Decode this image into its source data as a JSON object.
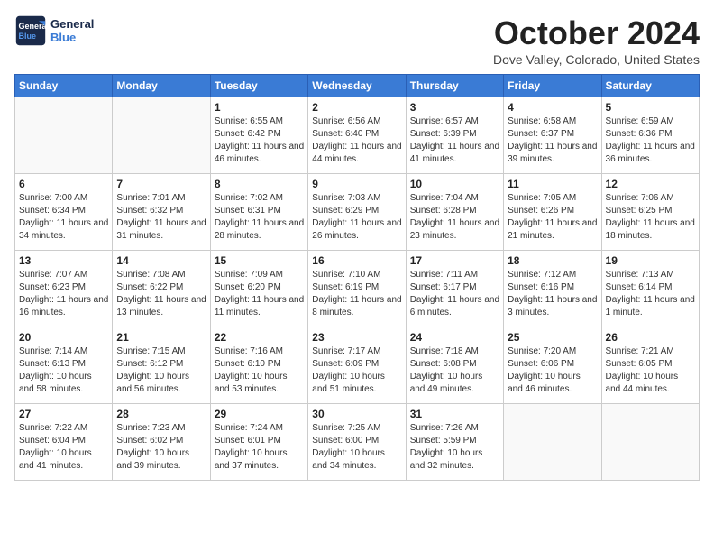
{
  "logo": {
    "line1": "General",
    "line2": "Blue"
  },
  "title": "October 2024",
  "location": "Dove Valley, Colorado, United States",
  "weekdays": [
    "Sunday",
    "Monday",
    "Tuesday",
    "Wednesday",
    "Thursday",
    "Friday",
    "Saturday"
  ],
  "weeks": [
    [
      {
        "day": "",
        "sunrise": "",
        "sunset": "",
        "daylight": ""
      },
      {
        "day": "",
        "sunrise": "",
        "sunset": "",
        "daylight": ""
      },
      {
        "day": "1",
        "sunrise": "Sunrise: 6:55 AM",
        "sunset": "Sunset: 6:42 PM",
        "daylight": "Daylight: 11 hours and 46 minutes."
      },
      {
        "day": "2",
        "sunrise": "Sunrise: 6:56 AM",
        "sunset": "Sunset: 6:40 PM",
        "daylight": "Daylight: 11 hours and 44 minutes."
      },
      {
        "day": "3",
        "sunrise": "Sunrise: 6:57 AM",
        "sunset": "Sunset: 6:39 PM",
        "daylight": "Daylight: 11 hours and 41 minutes."
      },
      {
        "day": "4",
        "sunrise": "Sunrise: 6:58 AM",
        "sunset": "Sunset: 6:37 PM",
        "daylight": "Daylight: 11 hours and 39 minutes."
      },
      {
        "day": "5",
        "sunrise": "Sunrise: 6:59 AM",
        "sunset": "Sunset: 6:36 PM",
        "daylight": "Daylight: 11 hours and 36 minutes."
      }
    ],
    [
      {
        "day": "6",
        "sunrise": "Sunrise: 7:00 AM",
        "sunset": "Sunset: 6:34 PM",
        "daylight": "Daylight: 11 hours and 34 minutes."
      },
      {
        "day": "7",
        "sunrise": "Sunrise: 7:01 AM",
        "sunset": "Sunset: 6:32 PM",
        "daylight": "Daylight: 11 hours and 31 minutes."
      },
      {
        "day": "8",
        "sunrise": "Sunrise: 7:02 AM",
        "sunset": "Sunset: 6:31 PM",
        "daylight": "Daylight: 11 hours and 28 minutes."
      },
      {
        "day": "9",
        "sunrise": "Sunrise: 7:03 AM",
        "sunset": "Sunset: 6:29 PM",
        "daylight": "Daylight: 11 hours and 26 minutes."
      },
      {
        "day": "10",
        "sunrise": "Sunrise: 7:04 AM",
        "sunset": "Sunset: 6:28 PM",
        "daylight": "Daylight: 11 hours and 23 minutes."
      },
      {
        "day": "11",
        "sunrise": "Sunrise: 7:05 AM",
        "sunset": "Sunset: 6:26 PM",
        "daylight": "Daylight: 11 hours and 21 minutes."
      },
      {
        "day": "12",
        "sunrise": "Sunrise: 7:06 AM",
        "sunset": "Sunset: 6:25 PM",
        "daylight": "Daylight: 11 hours and 18 minutes."
      }
    ],
    [
      {
        "day": "13",
        "sunrise": "Sunrise: 7:07 AM",
        "sunset": "Sunset: 6:23 PM",
        "daylight": "Daylight: 11 hours and 16 minutes."
      },
      {
        "day": "14",
        "sunrise": "Sunrise: 7:08 AM",
        "sunset": "Sunset: 6:22 PM",
        "daylight": "Daylight: 11 hours and 13 minutes."
      },
      {
        "day": "15",
        "sunrise": "Sunrise: 7:09 AM",
        "sunset": "Sunset: 6:20 PM",
        "daylight": "Daylight: 11 hours and 11 minutes."
      },
      {
        "day": "16",
        "sunrise": "Sunrise: 7:10 AM",
        "sunset": "Sunset: 6:19 PM",
        "daylight": "Daylight: 11 hours and 8 minutes."
      },
      {
        "day": "17",
        "sunrise": "Sunrise: 7:11 AM",
        "sunset": "Sunset: 6:17 PM",
        "daylight": "Daylight: 11 hours and 6 minutes."
      },
      {
        "day": "18",
        "sunrise": "Sunrise: 7:12 AM",
        "sunset": "Sunset: 6:16 PM",
        "daylight": "Daylight: 11 hours and 3 minutes."
      },
      {
        "day": "19",
        "sunrise": "Sunrise: 7:13 AM",
        "sunset": "Sunset: 6:14 PM",
        "daylight": "Daylight: 11 hours and 1 minute."
      }
    ],
    [
      {
        "day": "20",
        "sunrise": "Sunrise: 7:14 AM",
        "sunset": "Sunset: 6:13 PM",
        "daylight": "Daylight: 10 hours and 58 minutes."
      },
      {
        "day": "21",
        "sunrise": "Sunrise: 7:15 AM",
        "sunset": "Sunset: 6:12 PM",
        "daylight": "Daylight: 10 hours and 56 minutes."
      },
      {
        "day": "22",
        "sunrise": "Sunrise: 7:16 AM",
        "sunset": "Sunset: 6:10 PM",
        "daylight": "Daylight: 10 hours and 53 minutes."
      },
      {
        "day": "23",
        "sunrise": "Sunrise: 7:17 AM",
        "sunset": "Sunset: 6:09 PM",
        "daylight": "Daylight: 10 hours and 51 minutes."
      },
      {
        "day": "24",
        "sunrise": "Sunrise: 7:18 AM",
        "sunset": "Sunset: 6:08 PM",
        "daylight": "Daylight: 10 hours and 49 minutes."
      },
      {
        "day": "25",
        "sunrise": "Sunrise: 7:20 AM",
        "sunset": "Sunset: 6:06 PM",
        "daylight": "Daylight: 10 hours and 46 minutes."
      },
      {
        "day": "26",
        "sunrise": "Sunrise: 7:21 AM",
        "sunset": "Sunset: 6:05 PM",
        "daylight": "Daylight: 10 hours and 44 minutes."
      }
    ],
    [
      {
        "day": "27",
        "sunrise": "Sunrise: 7:22 AM",
        "sunset": "Sunset: 6:04 PM",
        "daylight": "Daylight: 10 hours and 41 minutes."
      },
      {
        "day": "28",
        "sunrise": "Sunrise: 7:23 AM",
        "sunset": "Sunset: 6:02 PM",
        "daylight": "Daylight: 10 hours and 39 minutes."
      },
      {
        "day": "29",
        "sunrise": "Sunrise: 7:24 AM",
        "sunset": "Sunset: 6:01 PM",
        "daylight": "Daylight: 10 hours and 37 minutes."
      },
      {
        "day": "30",
        "sunrise": "Sunrise: 7:25 AM",
        "sunset": "Sunset: 6:00 PM",
        "daylight": "Daylight: 10 hours and 34 minutes."
      },
      {
        "day": "31",
        "sunrise": "Sunrise: 7:26 AM",
        "sunset": "Sunset: 5:59 PM",
        "daylight": "Daylight: 10 hours and 32 minutes."
      },
      {
        "day": "",
        "sunrise": "",
        "sunset": "",
        "daylight": ""
      },
      {
        "day": "",
        "sunrise": "",
        "sunset": "",
        "daylight": ""
      }
    ]
  ]
}
